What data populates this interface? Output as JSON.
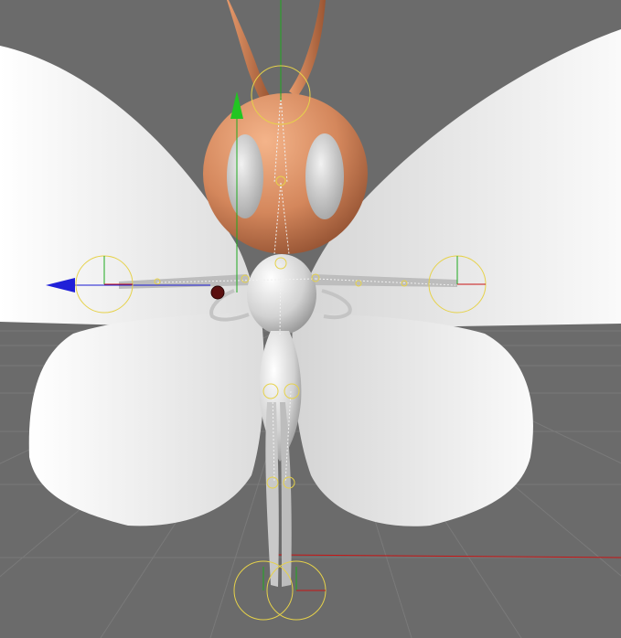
{
  "viewport": {
    "background": "#6b6b6b",
    "grid_color": "#7a7a7a",
    "axis_colors": {
      "x": "#c81414",
      "y": "#1faa1f",
      "z": "#1a1ad2"
    },
    "selection_color": "#e6d24a"
  },
  "character": {
    "head_color": "#d98a60",
    "body_color": "#d8d8d8",
    "wing_color": "#f2f2f2"
  },
  "icons": {
    "move_handle_y": "arrow-up-icon",
    "move_handle_z": "arrow-left-icon"
  }
}
